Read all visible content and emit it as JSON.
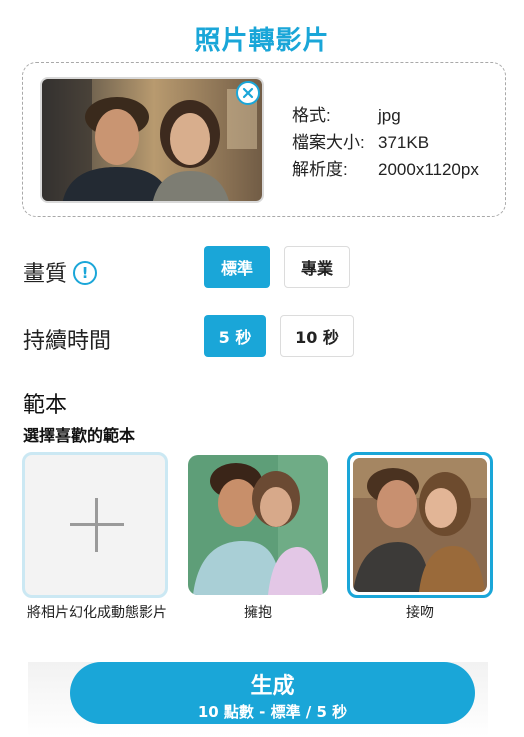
{
  "header": {
    "title": "照片轉影片"
  },
  "upload": {
    "format_label": "格式:",
    "format_value": "jpg",
    "size_label": "檔案大小:",
    "size_value": "371KB",
    "resolution_label": "解析度:",
    "resolution_value": "2000x1120px",
    "remove_icon": "close-circle-icon"
  },
  "quality": {
    "label": "畫質",
    "info_icon": "!",
    "options": [
      "標準",
      "專業"
    ],
    "selected": "標準"
  },
  "duration": {
    "label": "持續時間",
    "options": [
      "5 秒",
      "10 秒"
    ],
    "selected": "5 秒"
  },
  "templates": {
    "heading": "範本",
    "subheading": "選擇喜歡的範本",
    "items": [
      {
        "label": "將相片幻化成動態影片"
      },
      {
        "label": "擁抱"
      },
      {
        "label": "接吻"
      }
    ],
    "selected": "接吻"
  },
  "generate": {
    "label": "生成",
    "detail": "10 點數 - 標準 / 5 秒"
  },
  "colors": {
    "accent": "#1aa6d8"
  }
}
